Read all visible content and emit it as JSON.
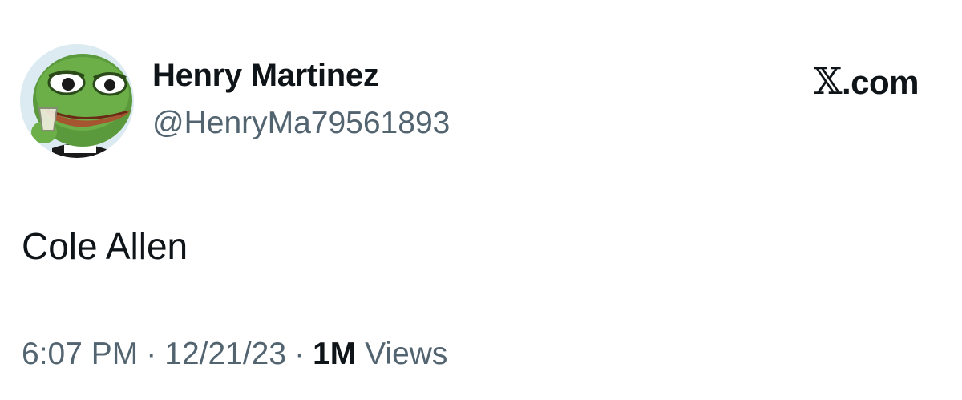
{
  "author": {
    "display_name": "Henry Martinez",
    "handle": "@HenryMa79561893",
    "avatar_icon": "frog-avatar-icon"
  },
  "brand": {
    "x_glyph": "𝕏",
    "suffix": ".com"
  },
  "tweet": {
    "text": "Cole Allen"
  },
  "meta": {
    "time": "6:07 PM",
    "separator": "·",
    "date": "12/21/23",
    "views_count": "1M",
    "views_label": "Views"
  },
  "colors": {
    "primary_text": "#0f1419",
    "secondary_text": "#536471",
    "background": "#ffffff"
  }
}
